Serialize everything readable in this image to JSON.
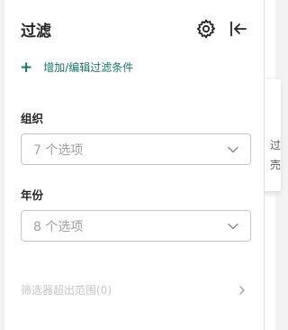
{
  "panel": {
    "title": "过滤",
    "settings_icon": "gear-icon",
    "collapse_icon": "collapse-left-icon",
    "add_filter_label": "增加/编辑过滤条件",
    "add_icon": "plus-icon"
  },
  "filters": [
    {
      "label": "组织",
      "placeholder": "7 个选项",
      "icon": "chevron-down-icon"
    },
    {
      "label": "年份",
      "placeholder": "8 个选项",
      "icon": "chevron-down-icon"
    }
  ],
  "footer": {
    "label": "筛选器超出范围(0)",
    "icon": "chevron-right-icon"
  },
  "peek": {
    "line1": "过",
    "line2": "売"
  },
  "colors": {
    "accent": "#117865",
    "border": "#c8c6c4",
    "placeholder": "#a19f9d"
  }
}
